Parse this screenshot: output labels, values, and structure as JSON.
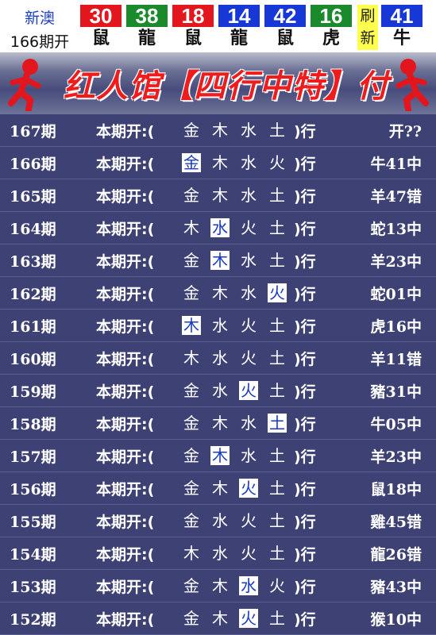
{
  "top_bar": {
    "label_top": "新澳",
    "label_bottom": "166期开",
    "balls": [
      {
        "number": "30",
        "zodiac": "鼠",
        "color": "#e3161e"
      },
      {
        "number": "38",
        "zodiac": "龍",
        "color": "#1a8a2c"
      },
      {
        "number": "18",
        "zodiac": "鼠",
        "color": "#e3161e"
      },
      {
        "number": "14",
        "zodiac": "龍",
        "color": "#1737d6"
      },
      {
        "number": "42",
        "zodiac": "鼠",
        "color": "#1737d6"
      },
      {
        "number": "16",
        "zodiac": "虎",
        "color": "#1a8a2c"
      },
      {
        "number": "41",
        "zodiac": "牛",
        "color": "#1737d6"
      }
    ],
    "refresh_label_1": "刷",
    "refresh_label_2": "新"
  },
  "banner": {
    "title": "红人馆【四行中特】付费版",
    "accent_color": "#ee1c1c"
  },
  "rows": [
    {
      "period": "167期",
      "prefix": "本期开:(",
      "elements": [
        "金",
        "木",
        "水",
        "土"
      ],
      "highlight": -1,
      "suffix": ")行",
      "result": "开??"
    },
    {
      "period": "166期",
      "prefix": "本期开:(",
      "elements": [
        "金",
        "木",
        "水",
        "火"
      ],
      "highlight": 0,
      "suffix": ")行",
      "result": "牛41中"
    },
    {
      "period": "165期",
      "prefix": "本期开:(",
      "elements": [
        "金",
        "木",
        "水",
        "土"
      ],
      "highlight": -1,
      "suffix": ")行",
      "result": "羊47错"
    },
    {
      "period": "164期",
      "prefix": "本期开:(",
      "elements": [
        "木",
        "水",
        "火",
        "土"
      ],
      "highlight": 1,
      "suffix": ")行",
      "result": "蛇13中"
    },
    {
      "period": "163期",
      "prefix": "本期开:(",
      "elements": [
        "金",
        "木",
        "水",
        "土"
      ],
      "highlight": 1,
      "suffix": ")行",
      "result": "羊23中"
    },
    {
      "period": "162期",
      "prefix": "本期开:(",
      "elements": [
        "金",
        "木",
        "水",
        "火"
      ],
      "highlight": 3,
      "suffix": ")行",
      "result": "蛇01中"
    },
    {
      "period": "161期",
      "prefix": "本期开:(",
      "elements": [
        "木",
        "水",
        "火",
        "土"
      ],
      "highlight": 0,
      "suffix": ")行",
      "result": "虎16中"
    },
    {
      "period": "160期",
      "prefix": "本期开:(",
      "elements": [
        "木",
        "水",
        "火",
        "土"
      ],
      "highlight": -1,
      "suffix": ")行",
      "result": "羊11错"
    },
    {
      "period": "159期",
      "prefix": "本期开:(",
      "elements": [
        "金",
        "水",
        "火",
        "土"
      ],
      "highlight": 2,
      "suffix": ")行",
      "result": "豬31中"
    },
    {
      "period": "158期",
      "prefix": "本期开:(",
      "elements": [
        "金",
        "木",
        "水",
        "土"
      ],
      "highlight": 3,
      "suffix": ")行",
      "result": "牛05中"
    },
    {
      "period": "157期",
      "prefix": "本期开:(",
      "elements": [
        "金",
        "木",
        "水",
        "土"
      ],
      "highlight": 1,
      "suffix": ")行",
      "result": "羊23中"
    },
    {
      "period": "156期",
      "prefix": "本期开:(",
      "elements": [
        "金",
        "木",
        "火",
        "土"
      ],
      "highlight": 2,
      "suffix": ")行",
      "result": "鼠18中"
    },
    {
      "period": "155期",
      "prefix": "本期开:(",
      "elements": [
        "金",
        "水",
        "火",
        "土"
      ],
      "highlight": -1,
      "suffix": ")行",
      "result": "雞45错"
    },
    {
      "period": "154期",
      "prefix": "本期开:(",
      "elements": [
        "木",
        "水",
        "火",
        "土"
      ],
      "highlight": -1,
      "suffix": ")行",
      "result": "龍26错"
    },
    {
      "period": "153期",
      "prefix": "本期开:(",
      "elements": [
        "金",
        "木",
        "水",
        "火"
      ],
      "highlight": 2,
      "suffix": ")行",
      "result": "豬43中"
    },
    {
      "period": "152期",
      "prefix": "本期开:(",
      "elements": [
        "金",
        "木",
        "火",
        "土"
      ],
      "highlight": 2,
      "suffix": ")行",
      "result": "猴10中"
    }
  ]
}
